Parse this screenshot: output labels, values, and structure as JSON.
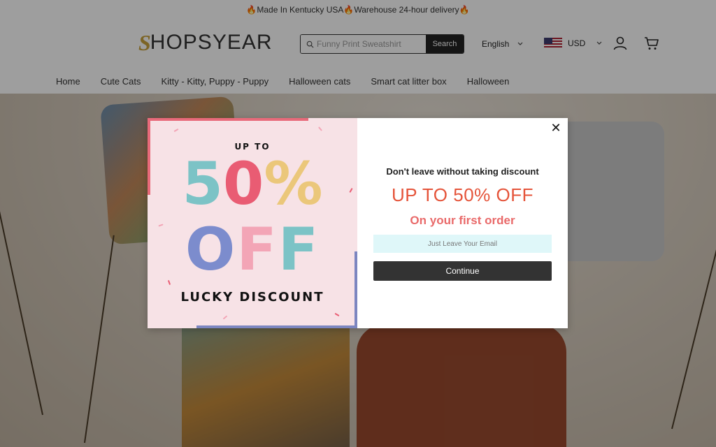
{
  "announcement": "🔥Made In Kentucky USA🔥Warehouse 24-hour delivery🔥",
  "header": {
    "logo_mark": "S",
    "logo_text": "HOPSYEAR",
    "search": {
      "placeholder": "Funny Print Sweatshirt",
      "button": "Search"
    },
    "language": "English",
    "currency": "USD",
    "icons": [
      "search-icon",
      "chevron-down-icon",
      "us-flag-icon",
      "user-icon",
      "cart-icon"
    ]
  },
  "nav": {
    "items": [
      "Home",
      "Cute Cats",
      "Kitty - Kitty, Puppy - Puppy",
      "Halloween cats",
      "Smart cat litter box",
      "Halloween"
    ]
  },
  "popup": {
    "promo": {
      "up_to": "UP TO",
      "big_digit_1": "5",
      "big_digit_2": "0",
      "big_percent": "%",
      "big_o": "O",
      "big_f1": "F",
      "big_f2": "F",
      "lucky": "LUCKY DISCOUNT"
    },
    "close": "✕",
    "headline": "Don't leave without taking discount",
    "offer": "UP TO 50% OFF",
    "first_order": "On your first order",
    "email_placeholder": "Just Leave Your Email",
    "continue": "Continue"
  },
  "colors": {
    "promo_bg": "#f7e2e6",
    "teal": "#7cc3c6",
    "pink": "#e95c73",
    "gold": "#ebc77a",
    "periwinkle": "#7c8ccd",
    "light_pink": "#f3a5b6",
    "offer_orange": "#e5543a",
    "first_order_coral": "#e96a6a",
    "email_bg": "#dff7f9",
    "button_dark": "#333333"
  }
}
